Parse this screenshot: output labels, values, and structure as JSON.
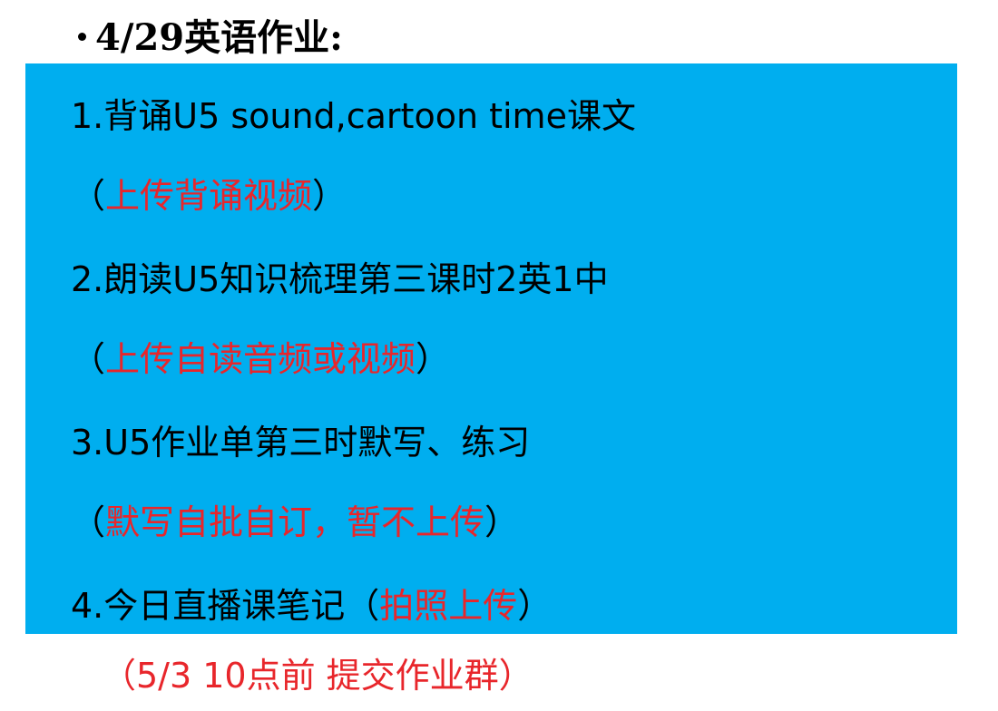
{
  "title": {
    "bullet": "•",
    "text": "4/29英语作业:"
  },
  "items": [
    {
      "main": "1.背诵U5 sound,cartoon time课文",
      "note_open": "（",
      "note": "上传背诵视频",
      "note_close": "）"
    },
    {
      "main": "2.朗读U5知识梳理第三课时2英1中",
      "note_open": "（",
      "note": "上传自读音频或视频",
      "note_close": "）"
    },
    {
      "main": "3.U5作业单第三时默写、练习",
      "note_open": "（",
      "note": "默写自批自订，暂不上传",
      "note_close": "）"
    },
    {
      "main": "4.今日直播课笔记",
      "note_open": "（",
      "note": "拍照上传",
      "note_close": "）"
    }
  ],
  "deadline": "（5/3 10点前 提交作业群）",
  "colors": {
    "box_background": "#00aeef",
    "note_red": "#e8262b",
    "text_black": "#000000"
  }
}
